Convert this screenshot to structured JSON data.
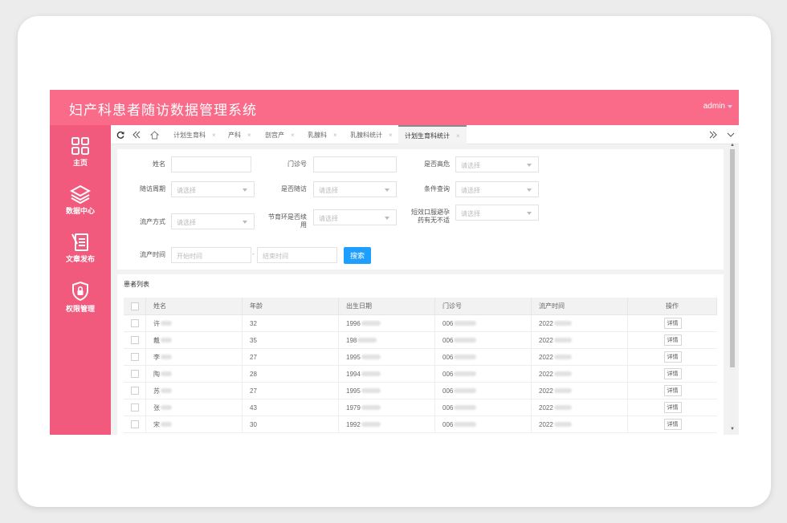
{
  "header": {
    "title": "妇产科患者随访数据管理系统",
    "user": "admin"
  },
  "sidebar": {
    "items": [
      {
        "label": "主页",
        "icon": "grid-icon"
      },
      {
        "label": "数据中心",
        "icon": "layers-icon"
      },
      {
        "label": "文章发布",
        "icon": "document-edit-icon"
      },
      {
        "label": "权限管理",
        "icon": "shield-lock-icon"
      }
    ]
  },
  "tabs": [
    {
      "label": "计划生育科",
      "active": false
    },
    {
      "label": "产科",
      "active": false
    },
    {
      "label": "剖宫产",
      "active": false
    },
    {
      "label": "乳腺科",
      "active": false
    },
    {
      "label": "乳腺科统计",
      "active": false
    },
    {
      "label": "计划生育科统计",
      "active": true
    }
  ],
  "filters": {
    "name_label": "姓名",
    "clinic_no_label": "门诊号",
    "high_risk_label": "是否高危",
    "follow_cycle_label": "随访周期",
    "is_followed_label": "是否随访",
    "condition_label": "条件查询",
    "abortion_method_label": "流产方式",
    "iud_label": "节育环是否续用",
    "ocp_label": "短效口服避孕药有无不适",
    "abortion_time_label": "流产时间",
    "select_placeholder": "请选择",
    "start_placeholder": "开始时间",
    "end_placeholder": "结束时间",
    "range_sep": "-",
    "search_button": "搜索"
  },
  "list": {
    "title": "患者列表",
    "columns": [
      "姓名",
      "年龄",
      "出生日期",
      "门诊号",
      "流产时间",
      "操作"
    ],
    "rows": [
      {
        "name": "许",
        "age": "32",
        "birth": "1996",
        "clinic": "006",
        "time": "2022",
        "action": "详情"
      },
      {
        "name": "戴",
        "age": "35",
        "birth": "198",
        "clinic": "006",
        "time": "2022",
        "action": "详情"
      },
      {
        "name": "李",
        "age": "27",
        "birth": "1995",
        "clinic": "006",
        "time": "2022",
        "action": "详情"
      },
      {
        "name": "陶",
        "age": "28",
        "birth": "1994",
        "clinic": "006",
        "time": "2022",
        "action": "详情"
      },
      {
        "name": "苏",
        "age": "27",
        "birth": "1995",
        "clinic": "006",
        "time": "2022",
        "action": "详情"
      },
      {
        "name": "张",
        "age": "43",
        "birth": "1979",
        "clinic": "006",
        "time": "2022",
        "action": "详情"
      },
      {
        "name": "宋",
        "age": "30",
        "birth": "1992",
        "clinic": "006",
        "time": "2022",
        "action": "详情"
      }
    ]
  },
  "colors": {
    "brand": "#fa6b8a",
    "sidebar": "#f15a7c",
    "primary_button": "#1e9fff"
  }
}
